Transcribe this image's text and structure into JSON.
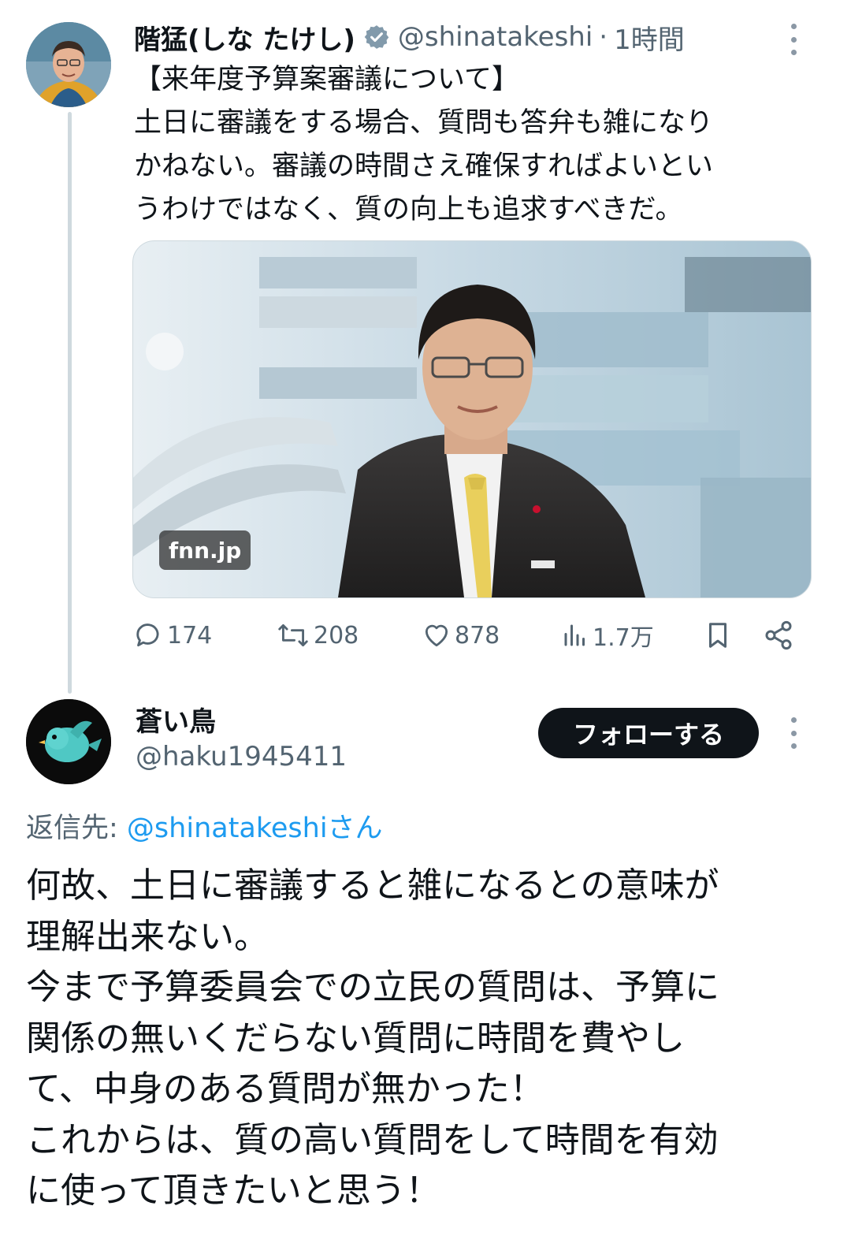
{
  "colors": {
    "text_primary": "#0f1419",
    "text_secondary": "#536471",
    "link": "#1d9bf0",
    "verified_badge": "#829aab",
    "follow_button_bg": "#0f1419",
    "thread_line": "#cfd9de"
  },
  "tweet1": {
    "author_name": "階猛(しな たけし)",
    "verified": true,
    "handle": "@shinatakeshi",
    "separator": "·",
    "time": "1時間",
    "text_lines": [
      "【来年度予算案審議について】",
      "土日に審議をする場合、質問も答弁も雑になり",
      "かねない。審議の時間さえ確保すればよいとい",
      "うわけではなく、質の向上も追求すべきだ。"
    ],
    "media": {
      "source_badge": "fnn.jp"
    },
    "actions": {
      "replies": "174",
      "retweets": "208",
      "likes": "878",
      "views": "1.7万"
    },
    "icons": [
      "verified-badge-icon",
      "more-icon",
      "reply-icon",
      "retweet-icon",
      "like-icon",
      "views-icon",
      "bookmark-icon",
      "share-icon"
    ]
  },
  "tweet2": {
    "author_name": "蒼い鳥",
    "handle": "@haku1945411",
    "follow_label": "フォローする",
    "reply_prefix": "返信先: ",
    "reply_mention": "@shinatakeshiさん",
    "text_lines": [
      "何故、土日に審議すると雑になるとの意味が",
      "理解出来ない。",
      "今まで予算委員会での立民の質問は、予算に",
      "関係の無いくだらない質問に時間を費やし",
      "て、中身のある質問が無かった！",
      "これからは、質の高い質問をして時間を有効",
      "に使って頂きたいと思う！"
    ]
  }
}
